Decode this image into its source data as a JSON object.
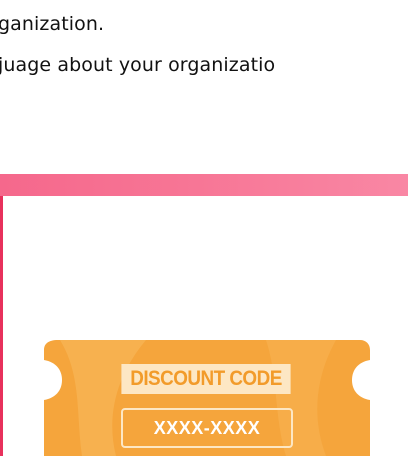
{
  "content": {
    "lines": [
      "ganization.",
      "juage about your organizatio"
    ]
  },
  "colors": {
    "header_band": "#f77595",
    "left_accent": "#e8315c",
    "ticket_body": "#f5a53c",
    "ticket_light": "#f7b454",
    "code_label_bg": "#fde7c4",
    "code_label_text": "#f29b2a"
  },
  "coupon": {
    "title": "DISCOUNT CODE",
    "code": "XXXX-XXXX"
  }
}
